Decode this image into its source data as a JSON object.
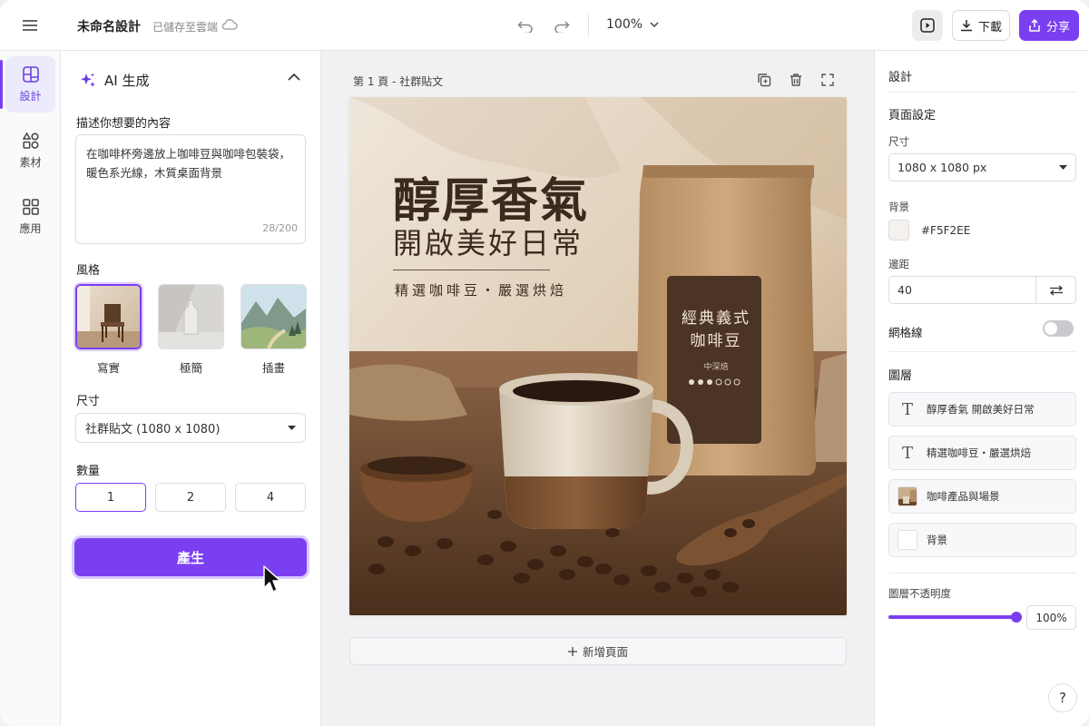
{
  "app": {
    "doc_title": "未命名設計",
    "save_status": "已儲存至雲端",
    "zoom": "100%",
    "download_label": "下載",
    "share_label": "分享",
    "colors": {
      "accent": "#7B3FF2",
      "panel_bg": "#FFFFFF",
      "canvas_bg": "#F1F1F3"
    }
  },
  "rail": {
    "items": [
      {
        "label": "設計",
        "icon": "layout-icon",
        "active": true
      },
      {
        "label": "素材",
        "icon": "shapes-icon",
        "active": false
      },
      {
        "label": "應用",
        "icon": "apps-grid-icon",
        "active": false
      }
    ]
  },
  "ai_panel": {
    "title": "AI 生成",
    "prompt_label": "描述你想要的內容",
    "prompt_value": "在咖啡杯旁邊放上咖啡豆與咖啡包裝袋，暖色系光線，木質桌面背景",
    "prompt_counter": "28/200",
    "style_label": "風格",
    "styles": [
      {
        "label": "寫實",
        "selected": true
      },
      {
        "label": "極簡",
        "selected": false
      },
      {
        "label": "插畫",
        "selected": false
      }
    ],
    "size_label": "尺寸",
    "size_value": "社群貼文 (1080 x 1080)",
    "quantity_label": "數量",
    "quantities": [
      {
        "label": "1",
        "selected": true
      },
      {
        "label": "2",
        "selected": false
      },
      {
        "label": "4",
        "selected": false
      }
    ],
    "generate_label": "產生"
  },
  "canvas": {
    "page_label": "第 1 頁 - 社群貼文",
    "headline_1": "醇厚香氣",
    "headline_2": "開啟美好日常",
    "tagline": "精選咖啡豆・嚴選烘焙",
    "bag_label_line1": "經典義式",
    "bag_label_line2": "咖啡豆",
    "bag_label_sub": "中深焙",
    "add_page_label": "新增頁面"
  },
  "right_panel": {
    "title": "設計",
    "page_settings_label": "頁面設定",
    "size_label": "尺寸",
    "size_value": "1080 x 1080 px",
    "background_label": "背景",
    "background_hex": "#F5F2EE",
    "margin_label": "邊距",
    "margin_value": "40",
    "grid_label": "網格線",
    "grid_on": false,
    "layers_label": "圖層",
    "layers": [
      {
        "label": "醇厚香氣 開啟美好日常",
        "kind": "text"
      },
      {
        "label": "精選咖啡豆・嚴選烘焙",
        "kind": "text"
      },
      {
        "label": "咖啡產品與場景",
        "kind": "image"
      },
      {
        "label": "背景",
        "kind": "background"
      }
    ],
    "opacity_label": "圖層不透明度",
    "opacity_value": "100%",
    "opacity_fraction": 1.0,
    "help_label": "?"
  }
}
